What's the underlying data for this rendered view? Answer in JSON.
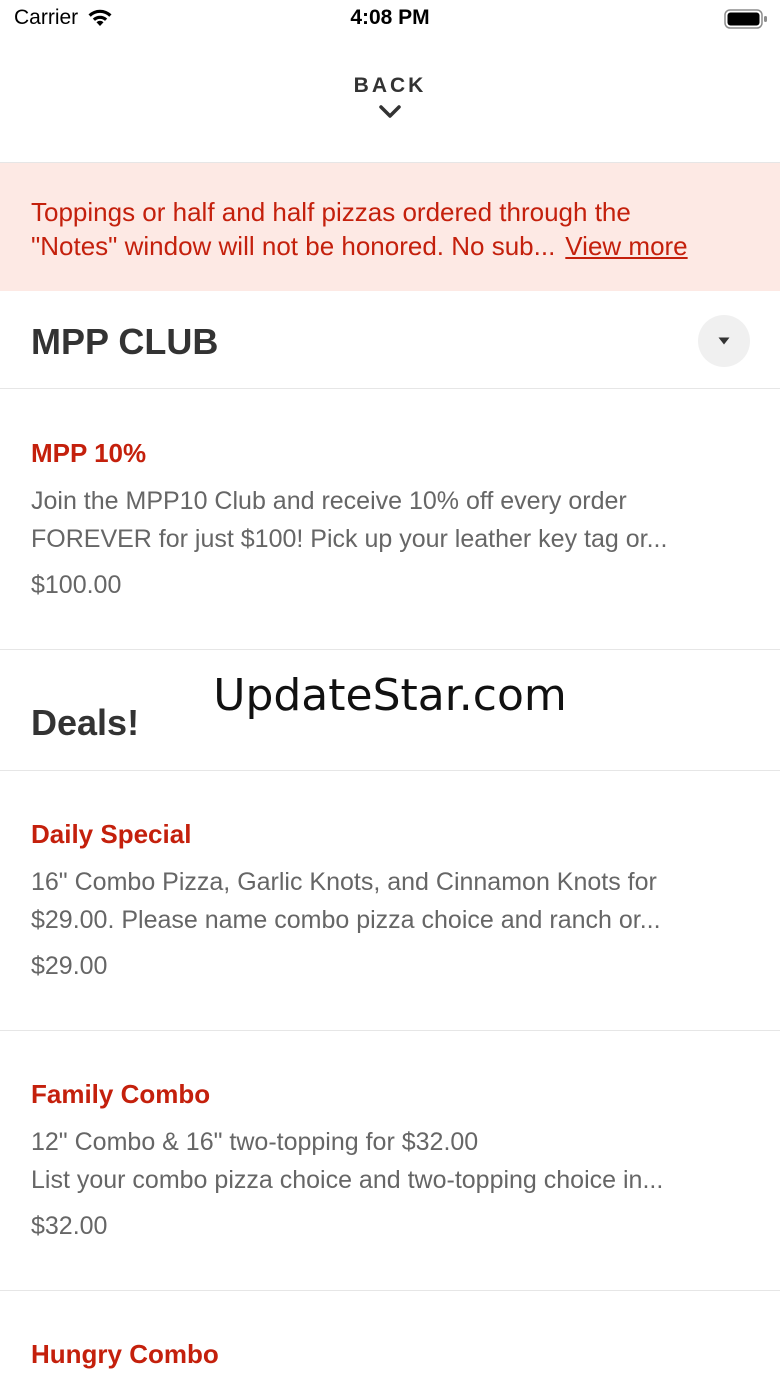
{
  "status_bar": {
    "carrier": "Carrier",
    "time": "4:08 PM"
  },
  "header": {
    "back_label": "BACK"
  },
  "notice": {
    "line1": "Toppings or half and half pizzas ordered through the",
    "line2": "\"Notes\" window will not be honored. No sub...",
    "view_more": "View more"
  },
  "sections": {
    "club": {
      "title": "MPP CLUB",
      "items": [
        {
          "name": "MPP 10%",
          "desc1": "Join the MPP10 Club and receive 10% off every order",
          "desc2": "FOREVER for just $100! Pick up your leather key tag or...",
          "price": "$100.00"
        }
      ]
    },
    "deals": {
      "title": "Deals!",
      "items": [
        {
          "name": "Daily Special",
          "desc1": "16\" Combo Pizza, Garlic Knots, and Cinnamon Knots for",
          "desc2": "$29.00.  Please name combo pizza choice and ranch or...",
          "price": "$29.00"
        },
        {
          "name": "Family Combo",
          "desc1": "12\" Combo & 16\" two-topping for $32.00",
          "desc2": "List your combo pizza choice and two-topping choice in...",
          "price": "$32.00"
        },
        {
          "name": "Hungry Combo"
        }
      ]
    }
  },
  "watermark": "UpdateStar.com",
  "colors": {
    "accent": "#c4200c",
    "notice_bg": "#fde9e4",
    "text_dark": "#333333",
    "text_muted": "#666666"
  }
}
